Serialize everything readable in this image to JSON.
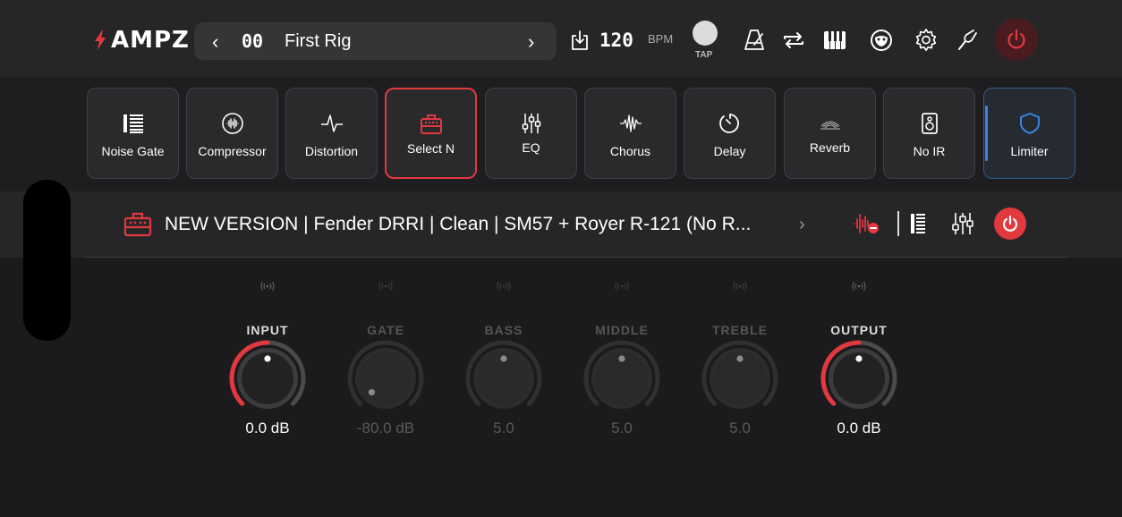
{
  "app": {
    "logo": "AMPZ"
  },
  "rig": {
    "prev": "‹",
    "number": "00",
    "name": "First Rig",
    "next": "›"
  },
  "tempo": {
    "bpm": "120",
    "unit": "BPM",
    "tap_label": "TAP"
  },
  "toolbar_icons": [
    "metronome-icon",
    "loop-icon",
    "piano-icon",
    "backing-track-icon",
    "settings-icon",
    "tuner-icon",
    "power-icon"
  ],
  "effects": [
    {
      "label": "Noise Gate",
      "icon": "noise-gate-icon",
      "state": "normal"
    },
    {
      "label": "Compressor",
      "icon": "compressor-icon",
      "state": "normal"
    },
    {
      "label": "Distortion",
      "icon": "distortion-icon",
      "state": "normal"
    },
    {
      "label": "Select N",
      "icon": "amp-icon",
      "state": "selected"
    },
    {
      "label": "EQ",
      "icon": "eq-icon",
      "state": "normal"
    },
    {
      "label": "Chorus",
      "icon": "chorus-icon",
      "state": "normal"
    },
    {
      "label": "Delay",
      "icon": "delay-icon",
      "state": "normal"
    },
    {
      "label": "Reverb",
      "icon": "reverb-icon",
      "state": "normal"
    },
    {
      "label": "No IR",
      "icon": "speaker-icon",
      "state": "normal"
    },
    {
      "label": "Limiter",
      "icon": "shield-icon",
      "state": "active"
    }
  ],
  "preset": {
    "title": "NEW VERSION | Fender DRRI | Clean | SM57 + Royer R-121 (No R...",
    "chevron": "›"
  },
  "knobs": [
    {
      "label": "INPUT",
      "value": "0.0 dB",
      "level": 0.5,
      "enabled": true
    },
    {
      "label": "GATE",
      "value": "-80.0 dB",
      "level": 0.0,
      "enabled": false
    },
    {
      "label": "BASS",
      "value": "5.0",
      "level": 0.5,
      "enabled": false
    },
    {
      "label": "MIDDLE",
      "value": "5.0",
      "level": 0.5,
      "enabled": false
    },
    {
      "label": "TREBLE",
      "value": "5.0",
      "level": 0.5,
      "enabled": false
    },
    {
      "label": "OUTPUT",
      "value": "0.0 dB",
      "level": 0.5,
      "enabled": true
    }
  ],
  "colors": {
    "accent_red": "#e2393f",
    "accent_blue": "#3a86e0",
    "background": "#1b1b1d"
  }
}
